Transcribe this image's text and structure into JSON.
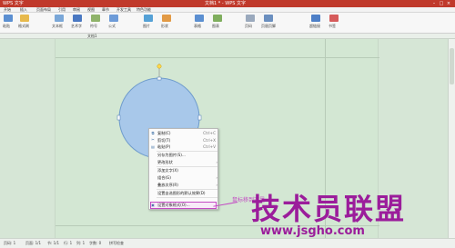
{
  "titlebar": {
    "brand": "WPS 文字",
    "doc_title": "文档1 * - WPS 文字"
  },
  "menubar": {
    "items": [
      "开始",
      "插入",
      "页面布局",
      "引用",
      "审阅",
      "视图",
      "章节",
      "开发工具",
      "特色功能"
    ]
  },
  "ribbon": {
    "groups": [
      "粘贴",
      "格式刷",
      "文本框",
      "艺术字",
      "符号",
      "公式",
      "图片",
      "形状",
      "表格",
      "图表",
      "页码",
      "页眉页脚",
      "超链接",
      "书签"
    ]
  },
  "tabstrip": {
    "items": [
      "文档1"
    ]
  },
  "context_menu": {
    "items": [
      {
        "label": "复制(C)",
        "shortcut": "Ctrl+C",
        "icon": "copy-icon"
      },
      {
        "label": "剪切(T)",
        "shortcut": "Ctrl+X",
        "icon": "cut-icon"
      },
      {
        "label": "粘贴(P)",
        "shortcut": "Ctrl+V",
        "icon": "paste-icon"
      },
      {
        "label": "另存为图片(S)...",
        "shortcut": "",
        "icon": ""
      },
      {
        "label": "更改形状",
        "shortcut": "",
        "icon": "",
        "arrow": true
      },
      {
        "label": "添加文字(X)",
        "shortcut": "",
        "icon": ""
      },
      {
        "label": "组合(G)",
        "shortcut": "",
        "icon": "",
        "arrow": true
      },
      {
        "label": "叠放次序(R)",
        "shortcut": "",
        "icon": "",
        "arrow": true
      },
      {
        "label": "设置自选图形的默认效果(D)",
        "shortcut": "",
        "icon": ""
      },
      {
        "label": "设置对象格式(O)...",
        "shortcut": "",
        "icon": "format-icon"
      }
    ]
  },
  "annotation": {
    "text": "鼠标移到这里"
  },
  "watermark": {
    "line1": "技术员联盟",
    "line2": "www.jsgho.com"
  },
  "statusbar": {
    "items": [
      "页码: 1",
      "页面: 1/1",
      "节: 1/1",
      "行: 1",
      "列: 1",
      "字数: 0",
      "拼写检查"
    ]
  },
  "colors": {
    "brand_red": "#c0392b",
    "circle_fill": "#a8c8ea",
    "watermark": "#9b1d9b",
    "highlight": "#c44bc4"
  }
}
